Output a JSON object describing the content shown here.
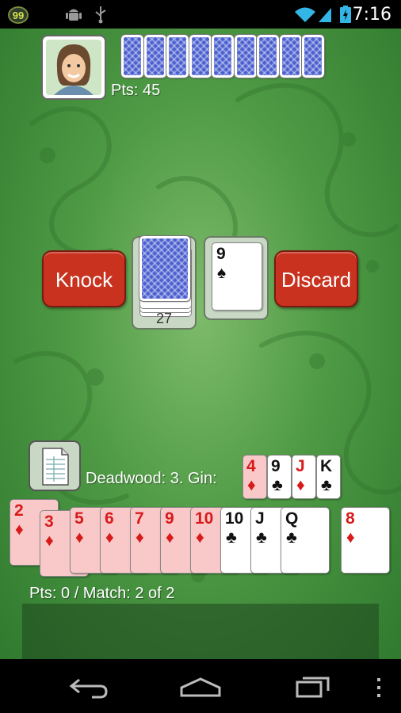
{
  "status_bar": {
    "notification_count": "99",
    "time": "7:16",
    "icons": [
      "android-debug-icon",
      "usb-icon",
      "wifi-icon",
      "signal-icon",
      "battery-icon"
    ]
  },
  "opponent": {
    "points": "Pts: 45",
    "hand_card_count": 9
  },
  "center": {
    "knock_label": "Knock",
    "discard_label": "Discard",
    "stock_count": "27",
    "discard_top": {
      "rank": "9",
      "suit": "♠",
      "color": "black"
    }
  },
  "player": {
    "deadwood_label": "Deadwood: 3. Gin:",
    "gin_cards": [
      {
        "rank": "4",
        "suit": "♦",
        "color": "red",
        "deadwood": true
      },
      {
        "rank": "9",
        "suit": "♣",
        "color": "black",
        "deadwood": false
      },
      {
        "rank": "J",
        "suit": "♦",
        "color": "red",
        "deadwood": false
      },
      {
        "rank": "K",
        "suit": "♣",
        "color": "black",
        "deadwood": false
      }
    ],
    "hand": [
      {
        "rank": "2",
        "suit": "♦",
        "color": "red",
        "deadwood": true
      },
      {
        "rank": "3",
        "suit": "♦",
        "color": "red",
        "deadwood": true
      },
      {
        "rank": "5",
        "suit": "♦",
        "color": "red",
        "deadwood": true
      },
      {
        "rank": "6",
        "suit": "♦",
        "color": "red",
        "deadwood": true
      },
      {
        "rank": "7",
        "suit": "♦",
        "color": "red",
        "deadwood": true
      },
      {
        "rank": "9",
        "suit": "♦",
        "color": "red",
        "deadwood": true
      },
      {
        "rank": "10",
        "suit": "♦",
        "color": "red",
        "deadwood": true
      },
      {
        "rank": "10",
        "suit": "♣",
        "color": "black",
        "deadwood": false
      },
      {
        "rank": "J",
        "suit": "♣",
        "color": "black",
        "deadwood": false
      },
      {
        "rank": "Q",
        "suit": "♣",
        "color": "black",
        "deadwood": false
      },
      {
        "rank": "8",
        "suit": "♦",
        "color": "red",
        "deadwood": false
      }
    ],
    "score": "Pts: 0 / Match: 2 of 2"
  },
  "colors": {
    "felt": "#4f9a45",
    "button": "#c8321f",
    "card_back": "#4b5fcf",
    "deadwood_tint": "#f9c9c9"
  }
}
